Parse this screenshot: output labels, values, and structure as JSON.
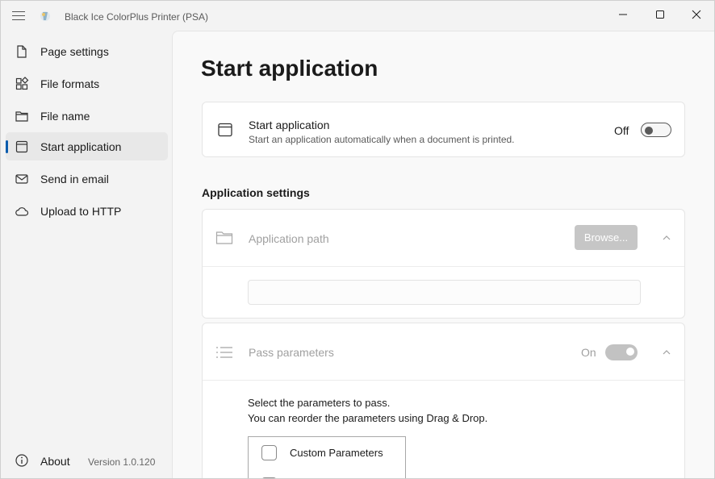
{
  "window": {
    "title": "Black Ice ColorPlus Printer (PSA)"
  },
  "sidebar": {
    "items": [
      {
        "label": "Page settings",
        "icon": "page-icon"
      },
      {
        "label": "File formats",
        "icon": "grid-icon"
      },
      {
        "label": "File name",
        "icon": "folder-icon"
      },
      {
        "label": "Start application",
        "icon": "window-icon",
        "active": true
      },
      {
        "label": "Send in email",
        "icon": "mail-icon"
      },
      {
        "label": "Upload to HTTP",
        "icon": "cloud-icon"
      }
    ],
    "about_label": "About",
    "version": "Version 1.0.120"
  },
  "main": {
    "title": "Start application",
    "start_card": {
      "title": "Start application",
      "description": "Start an application automatically when a document is printed.",
      "toggle_state": "Off"
    },
    "section_heading": "Application settings",
    "app_path": {
      "title": "Application path",
      "browse_label": "Browse...",
      "input_value": ""
    },
    "pass_params": {
      "title": "Pass parameters",
      "toggle_state": "On",
      "instruction_1": "Select the parameters to pass.",
      "instruction_2": "You can reorder the parameters using Drag & Drop.",
      "params": [
        {
          "label": "Custom Parameters",
          "checked": false
        }
      ]
    }
  },
  "colors": {
    "accent": "#0b5cad",
    "disabled_text": "#a0a0a0",
    "disabled_button": "#c6c6c6"
  }
}
